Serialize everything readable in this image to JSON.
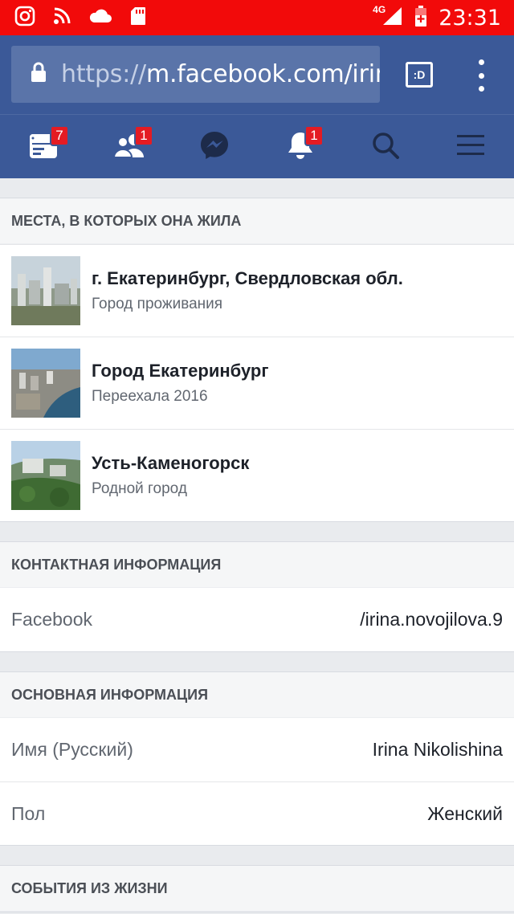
{
  "status_bar": {
    "network": "4G",
    "time": "23:31",
    "icons": [
      "instagram-icon",
      "rss-icon",
      "cloud-icon",
      "sd-card-icon",
      "signal-icon",
      "battery-charging-icon"
    ]
  },
  "browser": {
    "url_scheme": "https://",
    "url_rest": "m.facebook.com/irina.",
    "tabs_label": ":D"
  },
  "nav": {
    "items": [
      {
        "name": "news-feed",
        "badge": "7"
      },
      {
        "name": "friend-requests",
        "badge": "1"
      },
      {
        "name": "messenger",
        "badge": ""
      },
      {
        "name": "notifications",
        "badge": "1"
      },
      {
        "name": "search",
        "badge": ""
      },
      {
        "name": "menu",
        "badge": ""
      }
    ],
    "colors": {
      "bar": "#3b5998",
      "badge": "#e41b23"
    }
  },
  "places": {
    "header": "МЕСТА, В КОТОРЫХ ОНА ЖИЛА",
    "items": [
      {
        "title": "г. Екатеринбург, Свердловская обл.",
        "subtitle": "Город проживания"
      },
      {
        "title": "Город Екатеринбург",
        "subtitle": "Переехала 2016"
      },
      {
        "title": "Усть-Каменогорск",
        "subtitle": "Родной город"
      }
    ]
  },
  "contact": {
    "header": "КОНТАКТНАЯ ИНФОРМАЦИЯ",
    "rows": [
      {
        "key": "Facebook",
        "value": "/irina.novojilova.9"
      }
    ]
  },
  "basic": {
    "header": "ОСНОВНАЯ ИНФОРМАЦИЯ",
    "rows": [
      {
        "key": "Имя (Русский)",
        "value": "Irina Nikolishina"
      },
      {
        "key": "Пол",
        "value": "Женский"
      }
    ]
  },
  "life_events": {
    "header": "СОБЫТИЯ ИЗ ЖИЗНИ"
  }
}
